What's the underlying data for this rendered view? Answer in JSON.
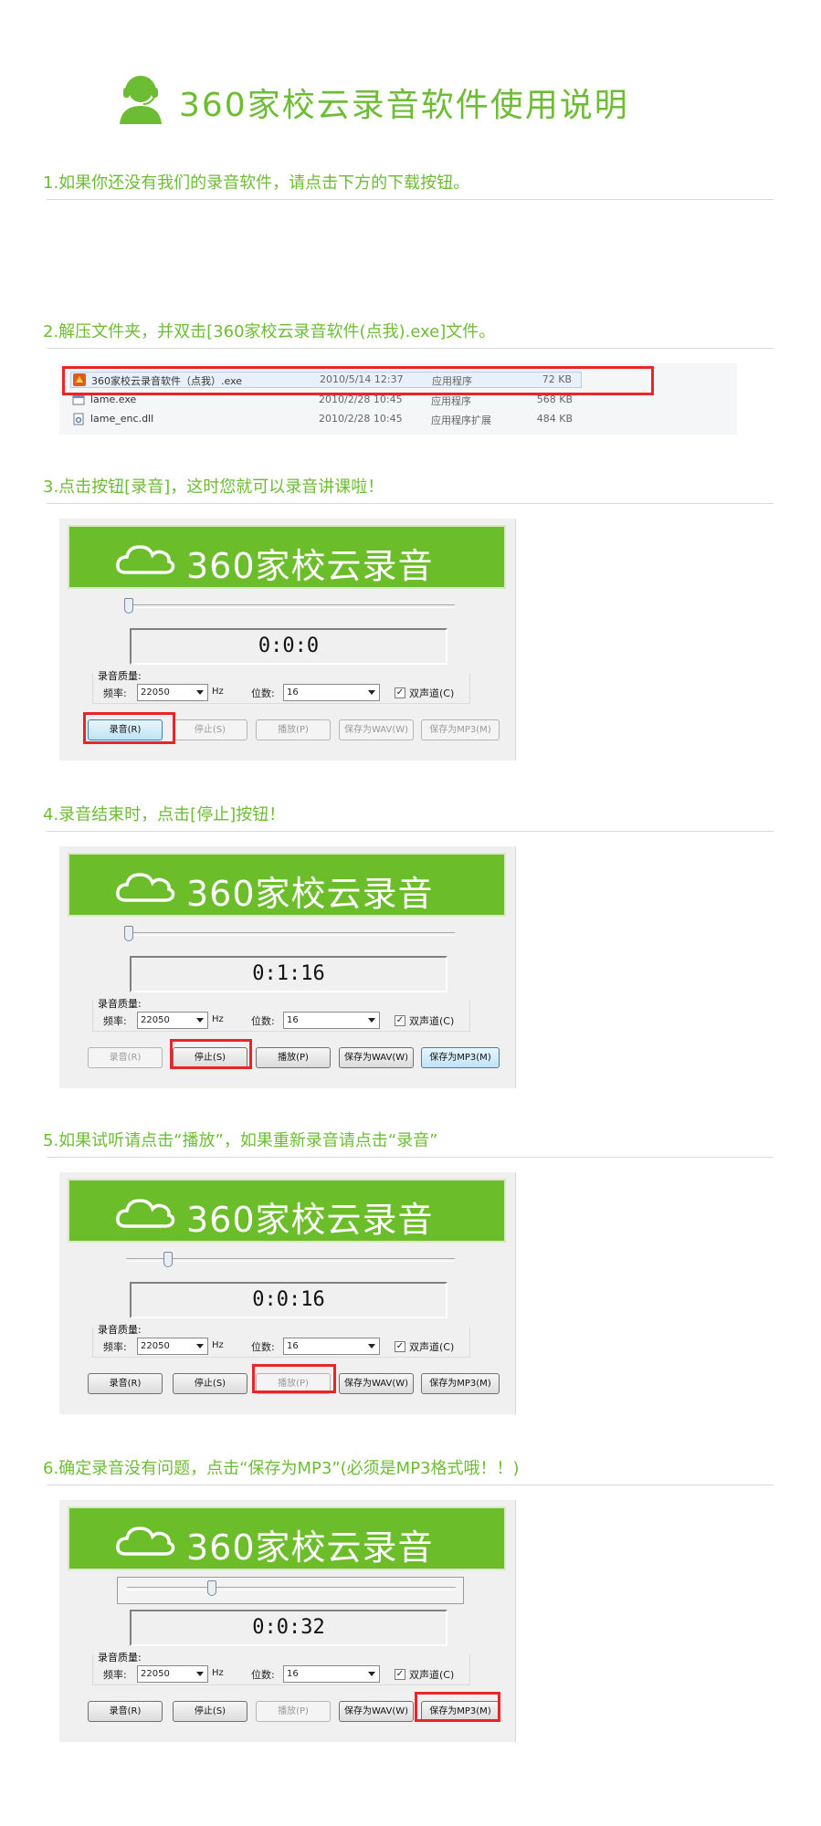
{
  "header": {
    "title": "360家校云录音软件使用说明"
  },
  "steps": [
    {
      "title": "1.如果你还没有我们的录音软件，请点击下方的下载按钮。"
    },
    {
      "title": "2.解压文件夹，并双击[360家校云录音软件(点我).exe]文件。"
    },
    {
      "title": "3.点击按钮[录音]，这时您就可以录音讲课啦！"
    },
    {
      "title": "4.录音结束时，点击[停止]按钮！"
    },
    {
      "title": "5.如果试听请点击“播放”，如果重新录音请点击“录音”"
    },
    {
      "title": "6.确定录音没有问题，点击“保存为MP3”(必须是MP3格式哦！！)"
    }
  ],
  "files": [
    {
      "name": "360家校云录音软件（点我）.exe",
      "date": "2010/5/14 12:37",
      "type": "应用程序",
      "size": "72 KB"
    },
    {
      "name": "lame.exe",
      "date": "2010/2/28 10:45",
      "type": "应用程序",
      "size": "568 KB"
    },
    {
      "name": "lame_enc.dll",
      "date": "2010/2/28 10:45",
      "type": "应用程序扩展",
      "size": "484 KB"
    }
  ],
  "recorder": {
    "banner_text": "360家校云录音",
    "quality_label": "录音质量:",
    "frequency_label": "频率:",
    "frequency_value": "22050",
    "hz_label": "Hz",
    "bit_depth_label": "位数:",
    "bit_depth_value": "16",
    "stereo_label": "双声道(C)",
    "buttons": {
      "record": "录音(R)",
      "stop": "停止(S)",
      "play": "播放(P)",
      "save_wav": "保存为WAV(W)",
      "save_mp3": "保存为MP3(M)"
    }
  },
  "windows": [
    {
      "timer": "0:0:0",
      "seek_fraction": 0.0
    },
    {
      "timer": "0:1:16",
      "seek_fraction": 0.0
    },
    {
      "timer": "0:0:16",
      "seek_fraction": 0.12
    },
    {
      "timer": "0:0:32",
      "seek_fraction": 0.25
    }
  ],
  "colors": {
    "accent_green": "#6dbd34",
    "highlight_red": "#e8262a"
  }
}
